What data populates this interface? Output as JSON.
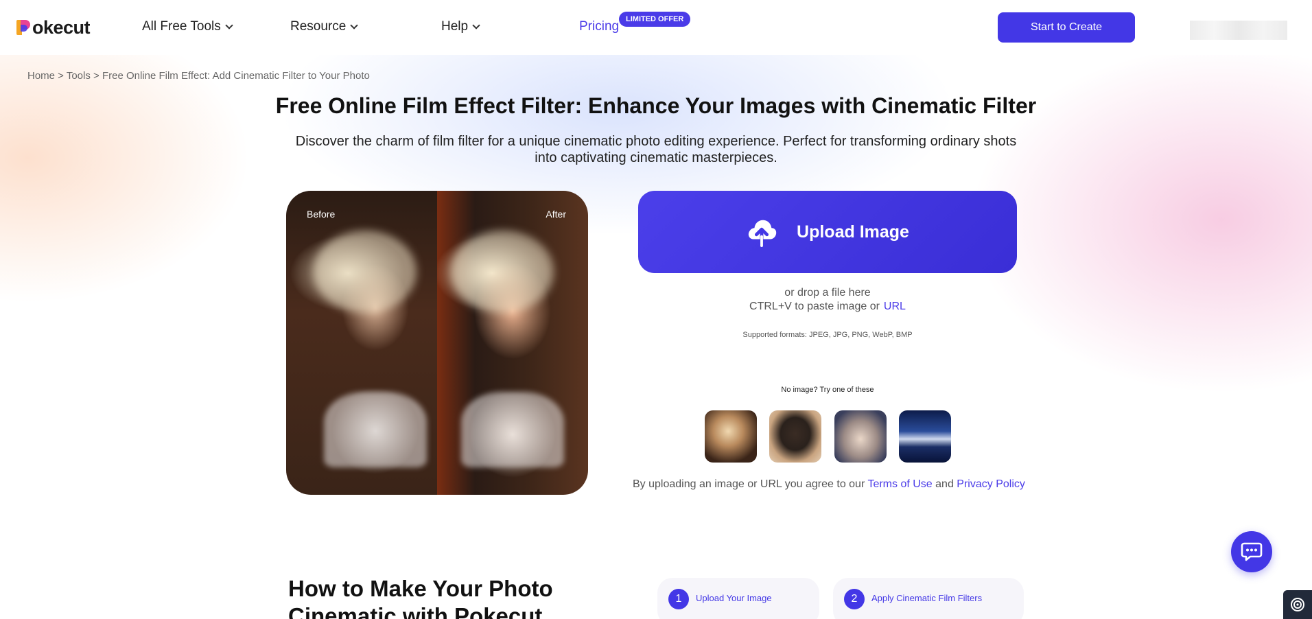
{
  "brand": {
    "logo_text": "okecut",
    "logo_icon": "pokecut-p-logo-icon"
  },
  "nav": {
    "all_free_tools": "All Free Tools",
    "resource": "Resource",
    "help": "Help",
    "pricing": "Pricing",
    "pricing_badge": "LIMITED OFFER",
    "cta": "Start to Create"
  },
  "breadcrumb": "Home > Tools > Free Online Film Effect: Add Cinematic Filter to Your Photo",
  "hero": {
    "title": "Free Online Film Effect Filter: Enhance Your Images with Cinematic Filter",
    "subtitle": "Discover the charm of film filter for a unique cinematic photo editing experience. Perfect for transforming ordinary shots into captivating cinematic masterpieces.",
    "before_label": "Before",
    "after_label": "After"
  },
  "upload": {
    "button_label": "Upload Image",
    "drop_text": "or drop a file here",
    "paste_text": "CTRL+V to paste image or",
    "url_link": "URL",
    "formats": "Supported formats: JPEG, JPG, PNG, WebP, BMP",
    "try_label": "No image? Try one of these",
    "agree_prefix": "By uploading an image or URL you agree to our",
    "terms": "Terms of Use",
    "and": "and",
    "privacy": "Privacy Policy"
  },
  "how": {
    "title": "How to Make Your Photo Cinematic with Pokecut",
    "steps": [
      {
        "num": "1",
        "label": "Upload Your Image"
      },
      {
        "num": "2",
        "label": "Apply Cinematic Film Filters"
      }
    ]
  },
  "colors": {
    "accent": "#4337e6",
    "link": "#4a3be8"
  }
}
